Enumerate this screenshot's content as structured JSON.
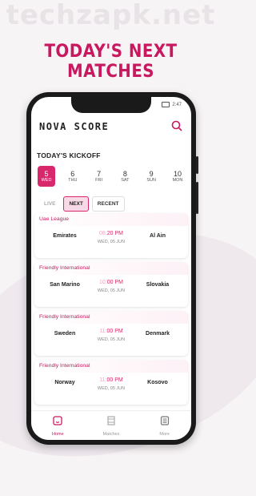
{
  "watermark": "techzapk.net",
  "headline": "TODAY'S NEXT MATCHES",
  "status_bar": {
    "time": "2:47"
  },
  "app": {
    "title": "NOVA SCORE"
  },
  "section_title": "TODAY'S KICKOFF",
  "dates": [
    {
      "num": "5",
      "day": "WED",
      "active": true
    },
    {
      "num": "6",
      "day": "THU"
    },
    {
      "num": "7",
      "day": "FRI"
    },
    {
      "num": "8",
      "day": "SAT"
    },
    {
      "num": "9",
      "day": "SUN"
    },
    {
      "num": "10",
      "day": "MON"
    }
  ],
  "tabs": {
    "live": "LIVE",
    "next": "NEXT",
    "recent": "RECENT"
  },
  "matches": [
    {
      "league": "Uae League",
      "home": "Emirates",
      "away": "Al Ain",
      "time_prefix": "08:",
      "time_rest": "20 PM",
      "date": "WED, 05 JUN"
    },
    {
      "league": "Friendly International",
      "home": "San Marino",
      "away": "Slovakia",
      "time_prefix": "10:",
      "time_rest": "00 PM",
      "date": "WED, 05 JUN"
    },
    {
      "league": "Friendly International",
      "home": "Sweden",
      "away": "Denmark",
      "time_prefix": "11:",
      "time_rest": "00 PM",
      "date": "WED, 05 JUN"
    },
    {
      "league": "Friendly International",
      "home": "Norway",
      "away": "Kosovo",
      "time_prefix": "11:",
      "time_rest": "00 PM",
      "date": "WED, 05 JUN"
    }
  ],
  "nav": {
    "home": "Home",
    "matches": "Matches",
    "more": "More"
  },
  "colors": {
    "accent": "#d8276b",
    "headline": "#c8185f"
  }
}
